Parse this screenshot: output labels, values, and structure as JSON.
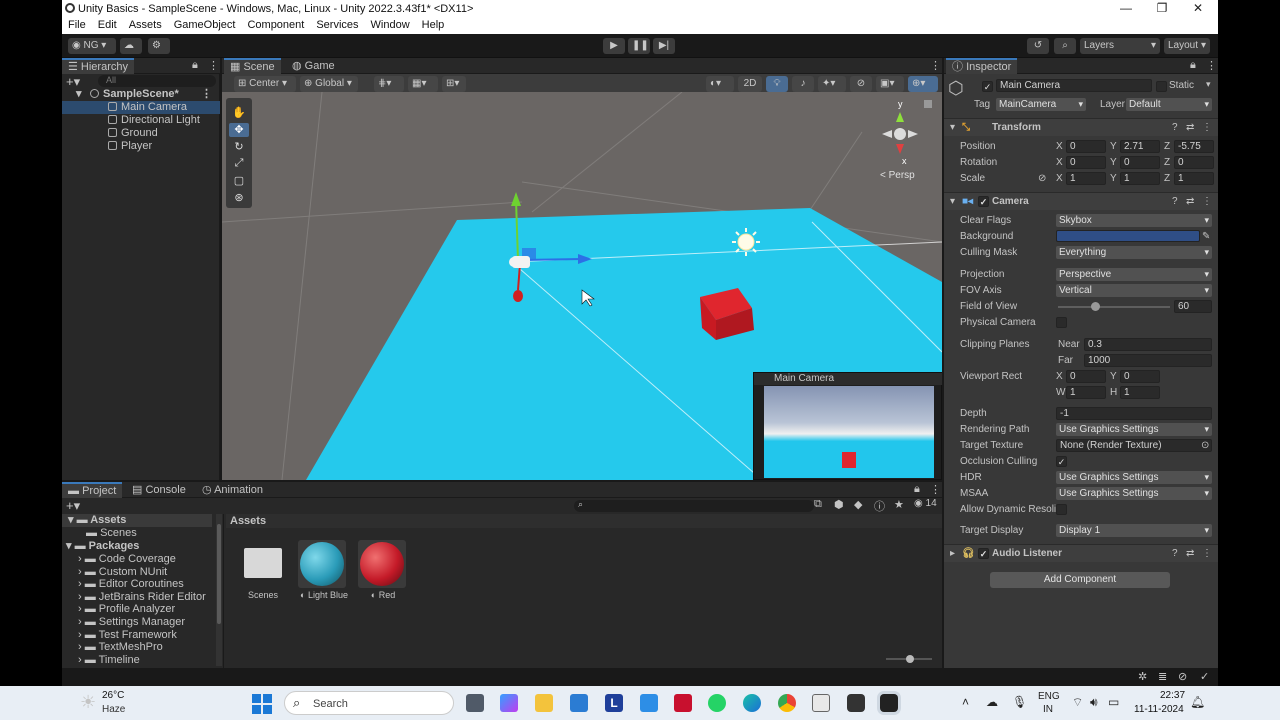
{
  "window": {
    "title": "Unity Basics - SampleScene - Windows, Mac, Linux - Unity 2022.3.43f1* <DX11>"
  },
  "menu": [
    "File",
    "Edit",
    "Assets",
    "GameObject",
    "Component",
    "Services",
    "Window",
    "Help"
  ],
  "toolbar": {
    "account": "NG",
    "layers_label": "Layers",
    "layout_label": "Layout"
  },
  "hierarchy": {
    "tab": "Hierarchy",
    "search_placeholder": "All",
    "scene": "SampleScene*",
    "items": [
      "Main Camera",
      "Directional Light",
      "Ground",
      "Player"
    ]
  },
  "scene": {
    "tabs": [
      "Scene",
      "Game"
    ],
    "pivot": "Center",
    "space": "Global",
    "mode_2d": "2D",
    "persp_label": "< Persp",
    "gizmo_y": "y",
    "gizmo_x": "x",
    "camera_preview_title": "Main Camera"
  },
  "project": {
    "tabs": [
      "Project",
      "Console",
      "Animation"
    ],
    "tree": {
      "assets": "Assets",
      "assets_children": [
        "Scenes"
      ],
      "packages": "Packages",
      "package_items": [
        "Code Coverage",
        "Custom NUnit",
        "Editor Coroutines",
        "JetBrains Rider Editor",
        "Profile Analyzer",
        "Settings Manager",
        "Test Framework",
        "TextMeshPro",
        "Timeline"
      ]
    },
    "breadcrumb": "Assets",
    "hidden_count": "14",
    "assets": [
      {
        "name": "Scenes",
        "kind": "folder"
      },
      {
        "name": "Light Blue",
        "kind": "material",
        "color": "#2a9bb8"
      },
      {
        "name": "Red",
        "kind": "material",
        "color": "#c41a28"
      }
    ]
  },
  "inspector": {
    "tab": "Inspector",
    "object_name": "Main Camera",
    "static_label": "Static",
    "tag_label": "Tag",
    "tag_value": "MainCamera",
    "layer_label": "Layer",
    "layer_value": "Default",
    "transform": {
      "title": "Transform",
      "position_label": "Position",
      "rotation_label": "Rotation",
      "scale_label": "Scale",
      "position": {
        "x": "0",
        "y": "2.71",
        "z": "-5.75"
      },
      "rotation": {
        "x": "0",
        "y": "0",
        "z": "0"
      },
      "scale": {
        "x": "1",
        "y": "1",
        "z": "1"
      }
    },
    "camera": {
      "title": "Camera",
      "clear_flags_label": "Clear Flags",
      "clear_flags": "Skybox",
      "background_label": "Background",
      "background_color": "#2f4e86",
      "culling_mask_label": "Culling Mask",
      "culling_mask": "Everything",
      "projection_label": "Projection",
      "projection": "Perspective",
      "fov_axis_label": "FOV Axis",
      "fov_axis": "Vertical",
      "fov_label": "Field of View",
      "fov": "60",
      "fov_slider_fraction": 0.33,
      "physical_label": "Physical Camera",
      "clipping_label": "Clipping Planes",
      "near_label": "Near",
      "near": "0.3",
      "far_label": "Far",
      "far": "1000",
      "viewport_label": "Viewport Rect",
      "vp_x": "0",
      "vp_y": "0",
      "vp_w": "1",
      "vp_h": "1",
      "depth_label": "Depth",
      "depth": "-1",
      "rendering_path_label": "Rendering Path",
      "rendering_path": "Use Graphics Settings",
      "target_texture_label": "Target Texture",
      "target_texture": "None (Render Texture)",
      "occlusion_label": "Occlusion Culling",
      "hdr_label": "HDR",
      "hdr": "Use Graphics Settings",
      "msaa_label": "MSAA",
      "msaa": "Use Graphics Settings",
      "dyn_res_label": "Allow Dynamic Resoli",
      "target_display_label": "Target Display",
      "target_display": "Display 1"
    },
    "audio_listener": "Audio Listener",
    "add_component": "Add Component"
  },
  "taskbar": {
    "temp": "26°C",
    "weather": "Haze",
    "search_placeholder": "Search",
    "lang1": "ENG",
    "lang2": "IN",
    "time": "22:37",
    "date": "11-11-2024"
  }
}
